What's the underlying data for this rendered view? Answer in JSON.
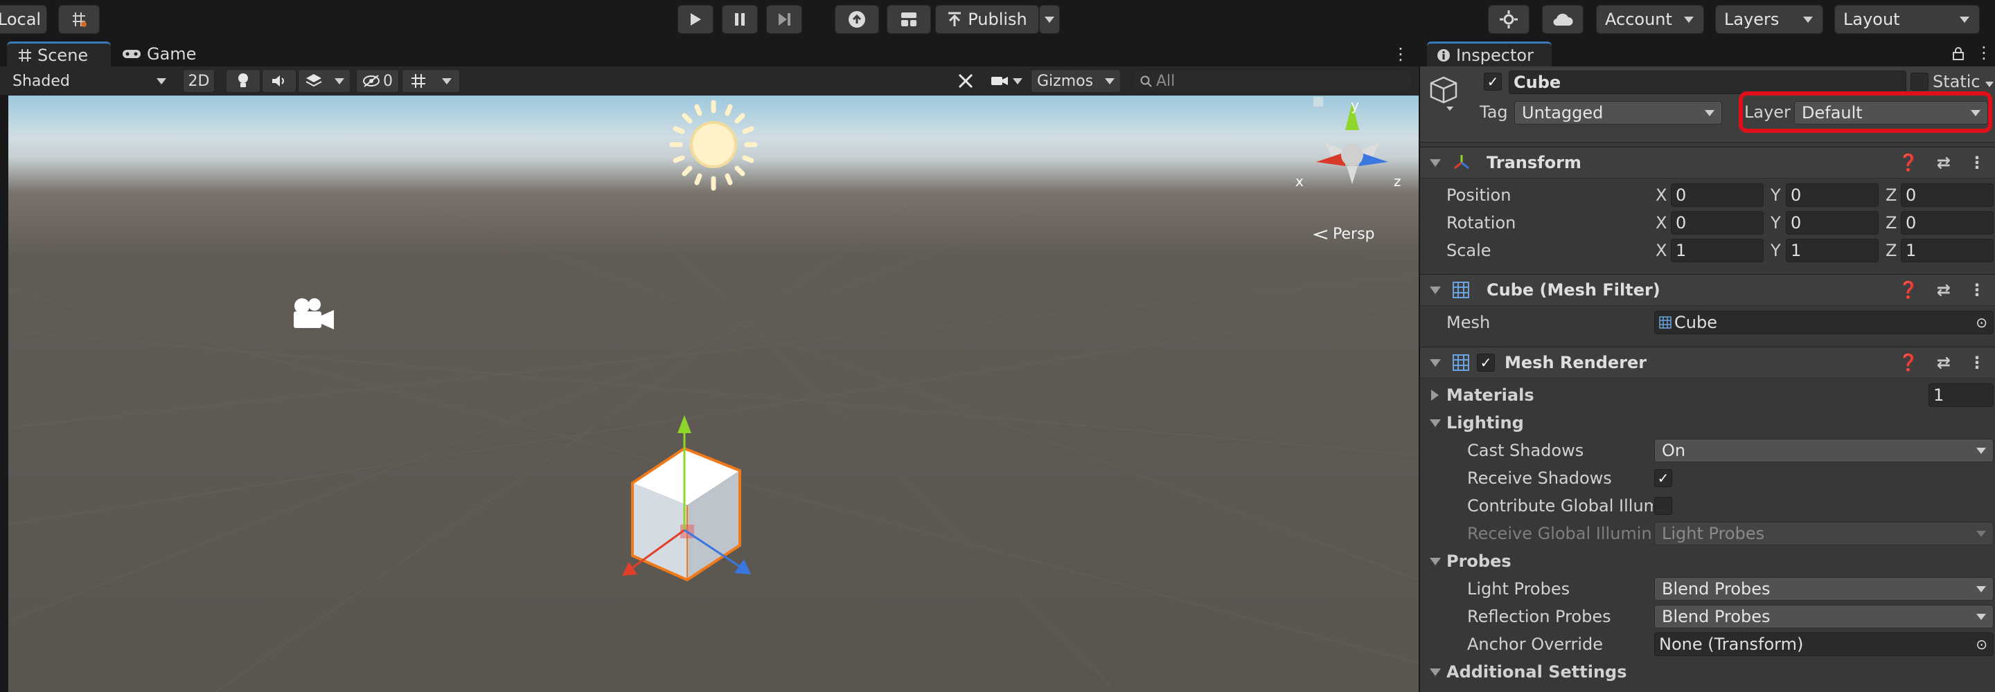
{
  "topbar": {
    "local_label": "Local",
    "play_icon": "play-icon",
    "pause_icon": "pause-icon",
    "step_icon": "step-icon",
    "publish_label": "Publish",
    "account_label": "Account",
    "layers_label": "Layers",
    "layout_label": "Layout"
  },
  "scene": {
    "tabs": [
      {
        "label": "Scene",
        "icon": "grid-icon"
      },
      {
        "label": "Game",
        "icon": "gamepad-icon"
      }
    ],
    "shading_mode": "Shaded",
    "toggle_2d": "2D",
    "hidden_count": "0",
    "gizmos_label": "Gizmos",
    "search_placeholder": "All",
    "persp_label": "Persp",
    "axis_x": "x",
    "axis_y": "y",
    "axis_z": "z"
  },
  "inspector": {
    "tab_label": "Inspector",
    "object_name": "Cube",
    "static_label": "Static",
    "tag_label": "Tag",
    "tag_value": "Untagged",
    "layer_label": "Layer",
    "layer_value": "Default",
    "highlight_color": "#e0101a",
    "transform": {
      "title": "Transform",
      "rows": [
        {
          "label": "Position",
          "x": "0",
          "y": "0",
          "z": "0"
        },
        {
          "label": "Rotation",
          "x": "0",
          "y": "0",
          "z": "0"
        },
        {
          "label": "Scale",
          "x": "1",
          "y": "1",
          "z": "1"
        }
      ],
      "axis_x": "X",
      "axis_y": "Y",
      "axis_z": "Z"
    },
    "mesh_filter": {
      "title": "Cube (Mesh Filter)",
      "mesh_label": "Mesh",
      "mesh_value": "Cube"
    },
    "mesh_renderer": {
      "title": "Mesh Renderer",
      "materials_label": "Materials",
      "materials_count": "1",
      "lighting_label": "Lighting",
      "cast_shadows_label": "Cast Shadows",
      "cast_shadows_value": "On",
      "receive_shadows_label": "Receive Shadows",
      "contribute_gi_label": "Contribute Global Illumir",
      "receive_gi_label": "Receive Global Illuminat",
      "receive_gi_value": "Light Probes",
      "probes_label": "Probes",
      "light_probes_label": "Light Probes",
      "light_probes_value": "Blend Probes",
      "reflection_probes_label": "Reflection Probes",
      "reflection_probes_value": "Blend Probes",
      "anchor_override_label": "Anchor Override",
      "anchor_override_value": "None (Transform)",
      "additional_settings_label": "Additional Settings"
    }
  }
}
